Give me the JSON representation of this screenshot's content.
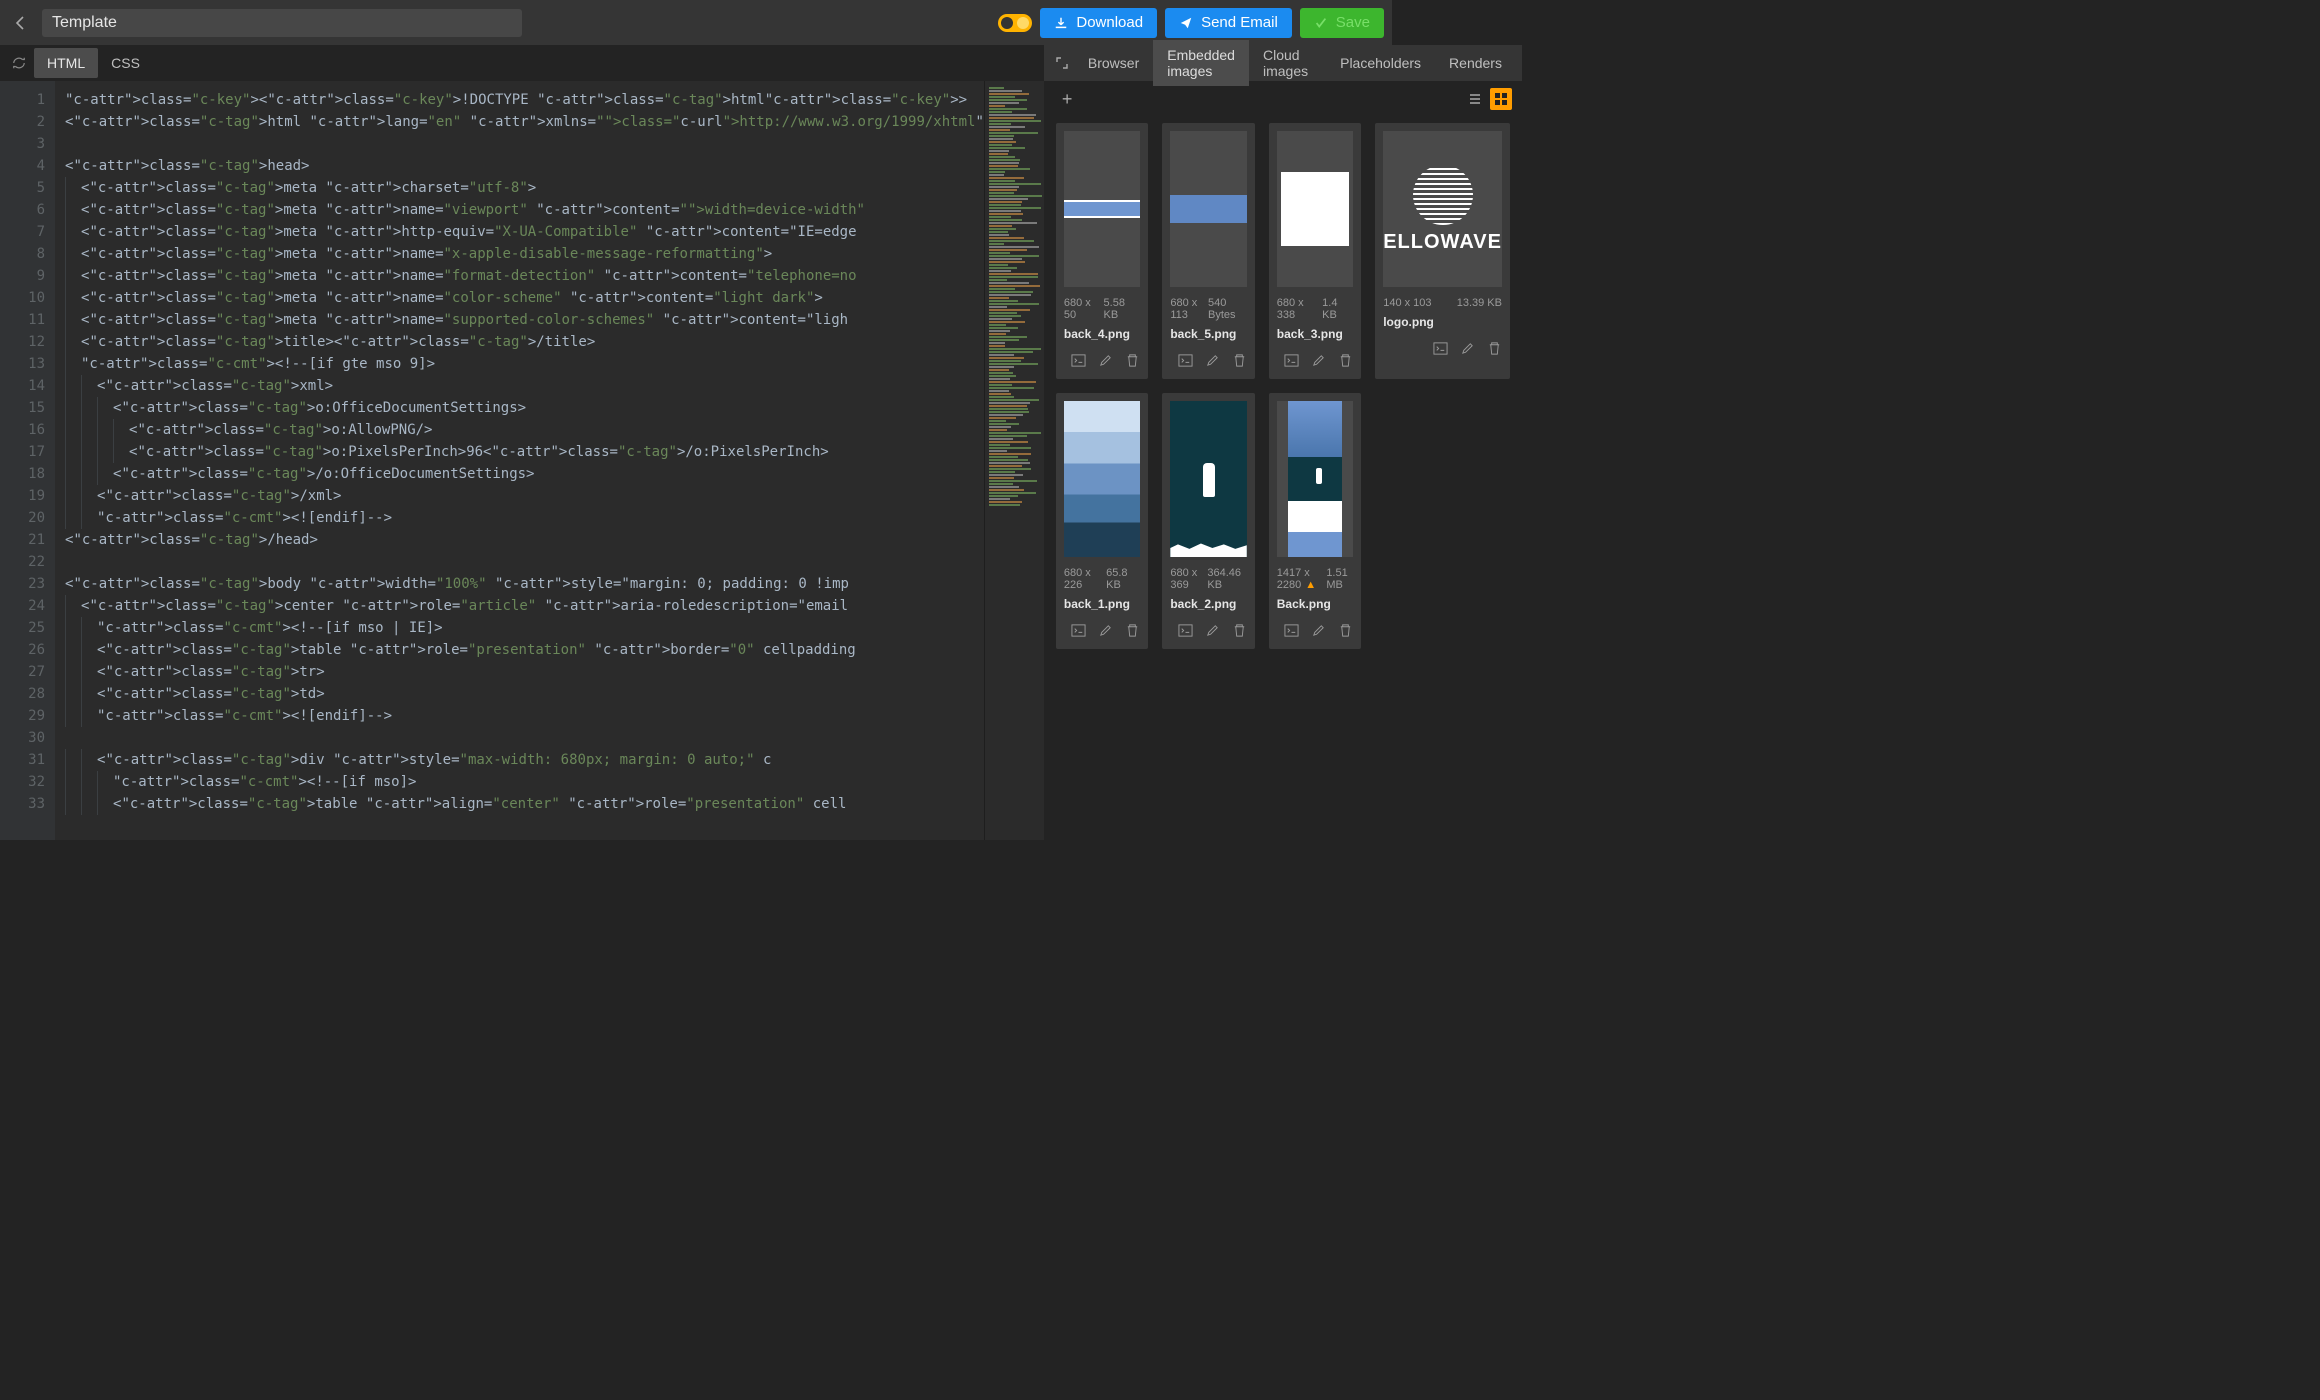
{
  "header": {
    "title": "Template",
    "download": "Download",
    "send_email": "Send Email",
    "save": "Save"
  },
  "editor_tabs": {
    "html": "HTML",
    "css": "CSS"
  },
  "preview_tabs": {
    "browser": "Browser",
    "embedded": "Embedded images",
    "cloud": "Cloud images",
    "placeholders": "Placeholders",
    "renders": "Renders"
  },
  "code_lines": [
    "<!DOCTYPE html>",
    "<html lang=\"en\" xmlns=\"http://www.w3.org/1999/xhtml\"",
    "",
    "<head>",
    "  <meta charset=\"utf-8\">",
    "  <meta name=\"viewport\" content=\"width=device-width\"",
    "  <meta http-equiv=\"X-UA-Compatible\" content=\"IE=edge",
    "  <meta name=\"x-apple-disable-message-reformatting\">",
    "  <meta name=\"format-detection\" content=\"telephone=no",
    "  <meta name=\"color-scheme\" content=\"light dark\">",
    "  <meta name=\"supported-color-schemes\" content=\"ligh",
    "  <title></title>",
    "  <!--[if gte mso 9]>",
    "    <xml>",
    "      <o:OfficeDocumentSettings>",
    "        <o:AllowPNG/>",
    "        <o:PixelsPerInch>96</o:PixelsPerInch>",
    "      </o:OfficeDocumentSettings>",
    "    </xml>",
    "    <![endif]-->",
    "</head>",
    "",
    "<body width=\"100%\" style=\"margin: 0; padding: 0 !imp",
    "  <center role=\"article\" aria-roledescription=\"email",
    "    <!--[if mso | IE]>",
    "    <table role=\"presentation\" border=\"0\" cellpadding",
    "    <tr>",
    "    <td>",
    "    <![endif]-->",
    "",
    "    <div style=\"max-width: 680px; margin: 0 auto;\" c",
    "      <!--[if mso]>",
    "      <table align=\"center\" role=\"presentation\" cell"
  ],
  "assets": [
    {
      "dims": "680 x 50",
      "size": "5.58 KB",
      "name": "back_4.png",
      "thumb": "wave-thin"
    },
    {
      "dims": "680 x 113",
      "size": "540 Bytes",
      "name": "back_5.png",
      "thumb": "blue-bar"
    },
    {
      "dims": "680 x 338",
      "size": "1.4 KB",
      "name": "back_3.png",
      "thumb": "white-rect"
    },
    {
      "dims": "140 x 103",
      "size": "13.39 KB",
      "name": "logo.png",
      "thumb": "logo",
      "logo_text": "ELLOWAVE"
    },
    {
      "dims": "680 x 226",
      "size": "65.8 KB",
      "name": "back_1.png",
      "thumb": "back1"
    },
    {
      "dims": "680 x 369",
      "size": "364.46 KB",
      "name": "back_2.png",
      "thumb": "back2"
    },
    {
      "dims": "1417 x 2280",
      "size": "1.51 MB",
      "name": "Back.png",
      "thumb": "back",
      "warn": true
    }
  ]
}
